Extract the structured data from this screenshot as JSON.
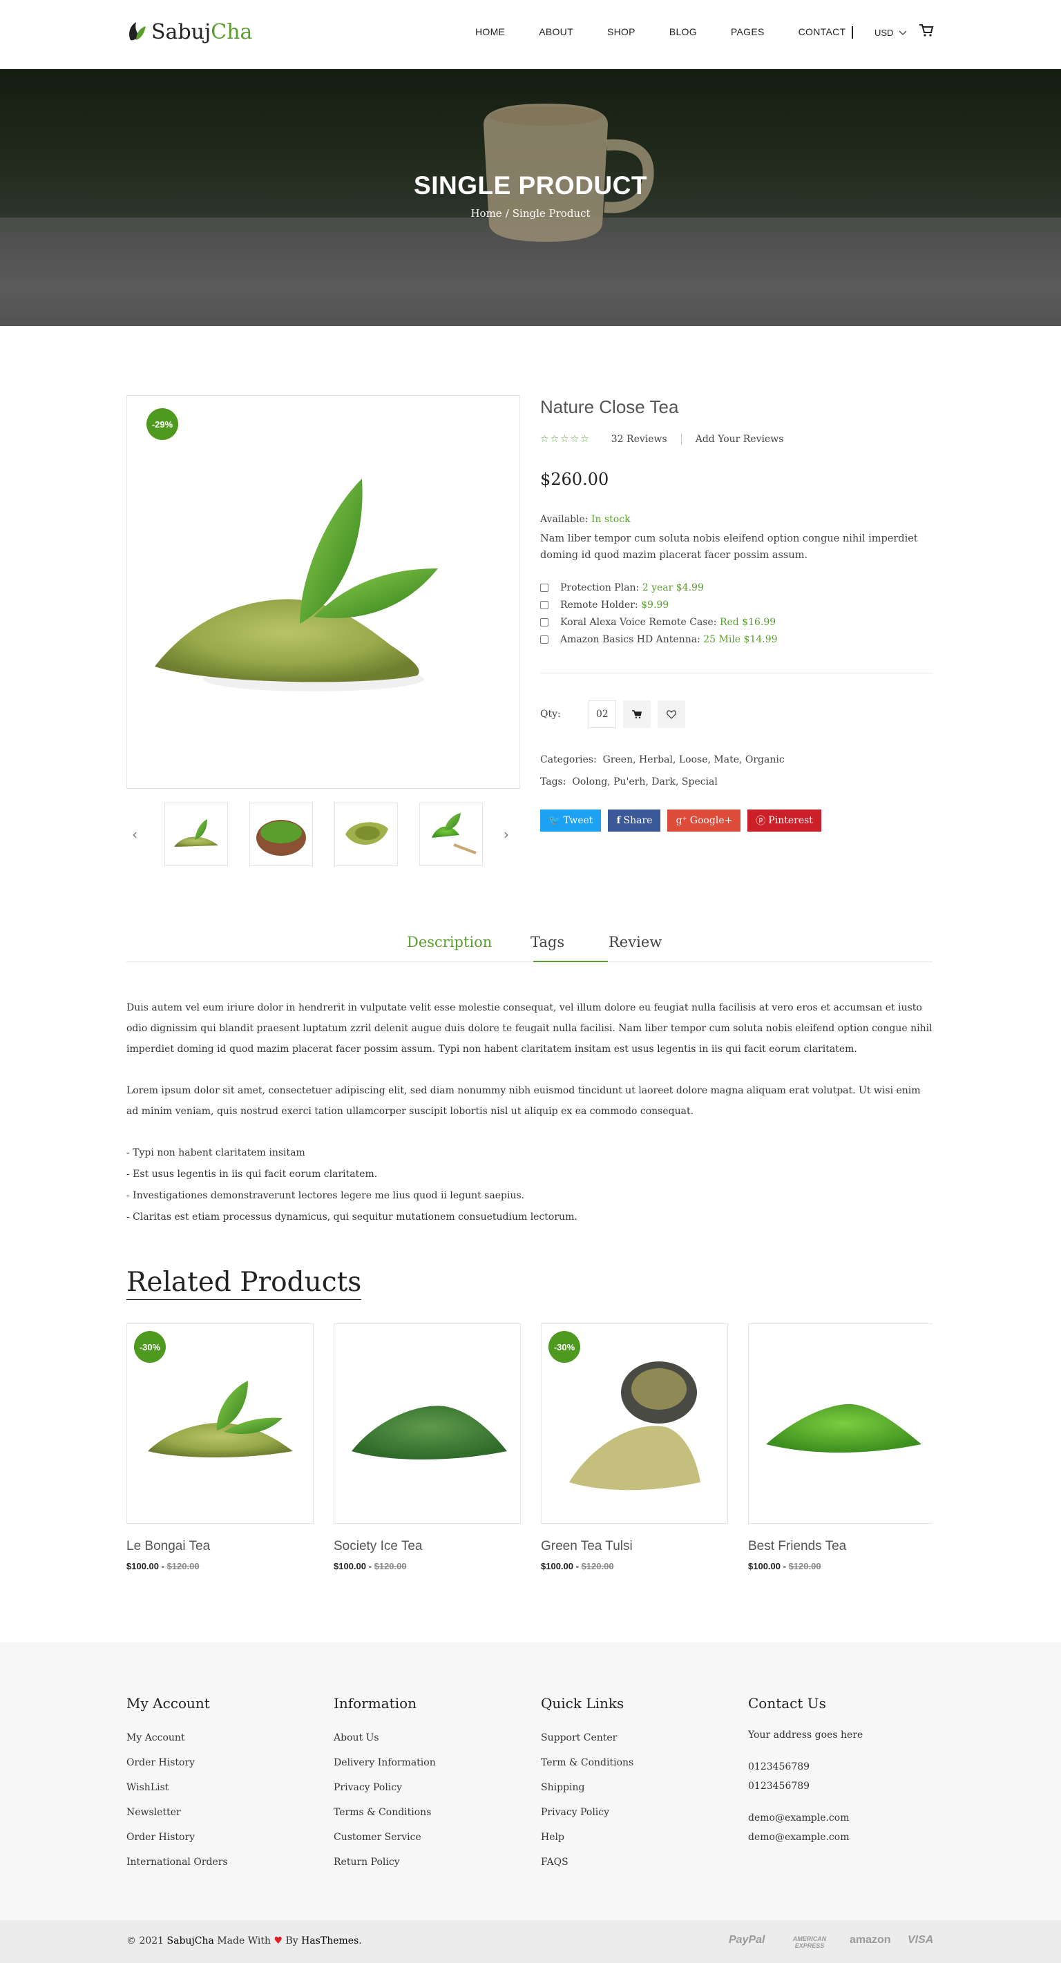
{
  "header": {
    "logo_sabuj": "Sabuj",
    "logo_cha": "Cha",
    "nav": [
      "HOME",
      "ABOUT",
      "SHOP",
      "BLOG",
      "PAGES",
      "CONTACT"
    ],
    "currency": "USD"
  },
  "hero": {
    "title": "SINGLE PRODUCT",
    "crumb_home": "Home",
    "crumb_sep": "/",
    "crumb_current": "Single Product"
  },
  "product": {
    "discount": "-29%",
    "name": "Nature Close Tea",
    "reviews": "32 Reviews",
    "add_review": "Add Your Reviews",
    "price": "$260.00",
    "avail_label": "Available:",
    "avail_value": "In stock",
    "description": "Nam liber tempor cum soluta nobis eleifend option congue nihil imperdiet doming id quod mazim placerat facer possim assum.",
    "options": [
      {
        "label": "Protection Plan:",
        "value": "2 year $4.99"
      },
      {
        "label": "Remote Holder:",
        "value": "$9.99"
      },
      {
        "label": "Koral Alexa Voice Remote Case:",
        "value": "Red $16.99"
      },
      {
        "label": "Amazon Basics HD Antenna:",
        "value": "25 Mile $14.99"
      }
    ],
    "qty_label": "Qty:",
    "qty_value": "02",
    "categories_label": "Categories:",
    "categories": "Green, Herbal, Loose, Mate, Organic",
    "tags_label": "Tags:",
    "tags": "Oolong, Pu'erh, Dark, Special",
    "share": [
      {
        "label": "Tweet",
        "icon": "twitter-icon",
        "color": "#1da1f2"
      },
      {
        "label": "Share",
        "icon": "facebook-icon",
        "color": "#3b5998"
      },
      {
        "label": "Google+",
        "icon": "google-plus-icon",
        "color": "#dd4b39"
      },
      {
        "label": "Pinterest",
        "icon": "pinterest-icon",
        "color": "#cb2027"
      }
    ]
  },
  "tabs": {
    "items": [
      "Description",
      "Tags",
      "Review"
    ],
    "paragraph1": "Duis autem vel eum iriure dolor in hendrerit in vulputate velit esse molestie consequat, vel illum dolore eu feugiat nulla facilisis at vero eros et accumsan et iusto odio dignissim qui blandit praesent luptatum zzril delenit augue duis dolore te feugait nulla facilisi. Nam liber tempor cum soluta nobis eleifend option congue nihil imperdiet doming id quod mazim placerat facer possim assum. Typi non habent claritatem insitam est usus legentis in iis qui facit eorum claritatem.",
    "paragraph2": "Lorem ipsum dolor sit amet, consectetuer adipiscing elit, sed diam nonummy nibh euismod tincidunt ut laoreet dolore magna aliquam erat volutpat. Ut wisi enim ad minim veniam, quis nostrud exerci tation ullamcorper suscipit lobortis nisl ut aliquip ex ea commodo consequat.",
    "list": [
      "- Typi non habent claritatem insitam",
      "- Est usus legentis in iis qui facit eorum claritatem.",
      "- Investigationes demonstraverunt lectores legere me lius quod ii legunt saepius.",
      "- Claritas est etiam processus dynamicus, qui sequitur mutationem consuetudium lectorum."
    ]
  },
  "related": {
    "title": "Related Products",
    "items": [
      {
        "name": "Le Bongai Tea",
        "price": "$100.00 -",
        "old": "$120.00",
        "badge": "-30%"
      },
      {
        "name": "Society Ice Tea",
        "price": "$100.00 -",
        "old": "$120.00",
        "badge": ""
      },
      {
        "name": "Green Tea Tulsi",
        "price": "$100.00 -",
        "old": "$120.00",
        "badge": "-30%"
      },
      {
        "name": "Best Friends Tea",
        "price": "$100.00 -",
        "old": "$120.00",
        "badge": ""
      }
    ]
  },
  "footer": {
    "my_account": {
      "title": "My Account",
      "links": [
        "My Account",
        "Order History",
        "WishList",
        "Newsletter",
        "Order History",
        "International Orders"
      ]
    },
    "information": {
      "title": "Information",
      "links": [
        "About Us",
        "Delivery Information",
        "Privacy Policy",
        "Terms & Conditions",
        "Customer Service",
        "Return Policy"
      ]
    },
    "quick_links": {
      "title": "Quick Links",
      "links": [
        "Support Center",
        "Term & Conditions",
        "Shipping",
        "Privacy Policy",
        "Help",
        "FAQS"
      ]
    },
    "contact": {
      "title": "Contact Us",
      "address": "Your address goes here",
      "phone1": "0123456789",
      "phone2": "0123456789",
      "email1": "demo@example.com",
      "email2": "demo@example.com"
    }
  },
  "copyright": {
    "prefix": "© 2021",
    "brand": "SabujCha",
    "made_with": "Made With",
    "by": "By",
    "company": "HasThemes",
    "end": "."
  },
  "payments": [
    "PayPal",
    "AMERICAN EXPRESS",
    "amazon",
    "VISA"
  ]
}
